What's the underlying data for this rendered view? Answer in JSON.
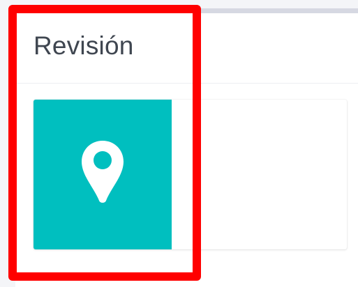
{
  "panel": {
    "title": "Revisión"
  },
  "card": {
    "icon": "map-pin-icon"
  },
  "colors": {
    "tile": "#00bfbf",
    "highlight": "#ff0000",
    "title_text": "#3f4650"
  }
}
